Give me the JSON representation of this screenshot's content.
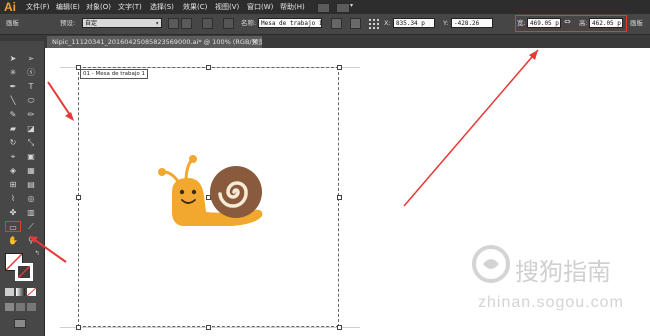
{
  "app": {
    "logo": "Ai"
  },
  "menu": [
    "文件(F)",
    "编辑(E)",
    "对象(O)",
    "文字(T)",
    "选择(S)",
    "效果(C)",
    "视图(V)",
    "窗口(W)",
    "帮助(H)"
  ],
  "control_bar": {
    "panel_label": "画板",
    "preset_label": "预设:",
    "preset_value": "自定",
    "name_label": "名称:",
    "name_value": "Mesa de trabajo 1",
    "x_label": "X:",
    "x_value": "835.34 p",
    "y_label": "Y:",
    "y_value": "-428.26",
    "w_label": "宽:",
    "w_value": "469.05 p",
    "h_label": "高:",
    "h_value": "462.05 p",
    "panel_label_right": "画板"
  },
  "document_tab": {
    "title": "Nipic_11120341_20160425085823569000.ai* @ 100% (RGB/预览)",
    "close": "×"
  },
  "artboard": {
    "label": "01 - Mesa de trabajo 1"
  },
  "watermark": {
    "text": "搜狗指南",
    "url": "zhinan.sogou.com"
  },
  "colors": {
    "annotation": "#e53935",
    "snail_body": "#f2a72e",
    "snail_shell": "#8a5a3c",
    "logo": "#f2a12b"
  }
}
